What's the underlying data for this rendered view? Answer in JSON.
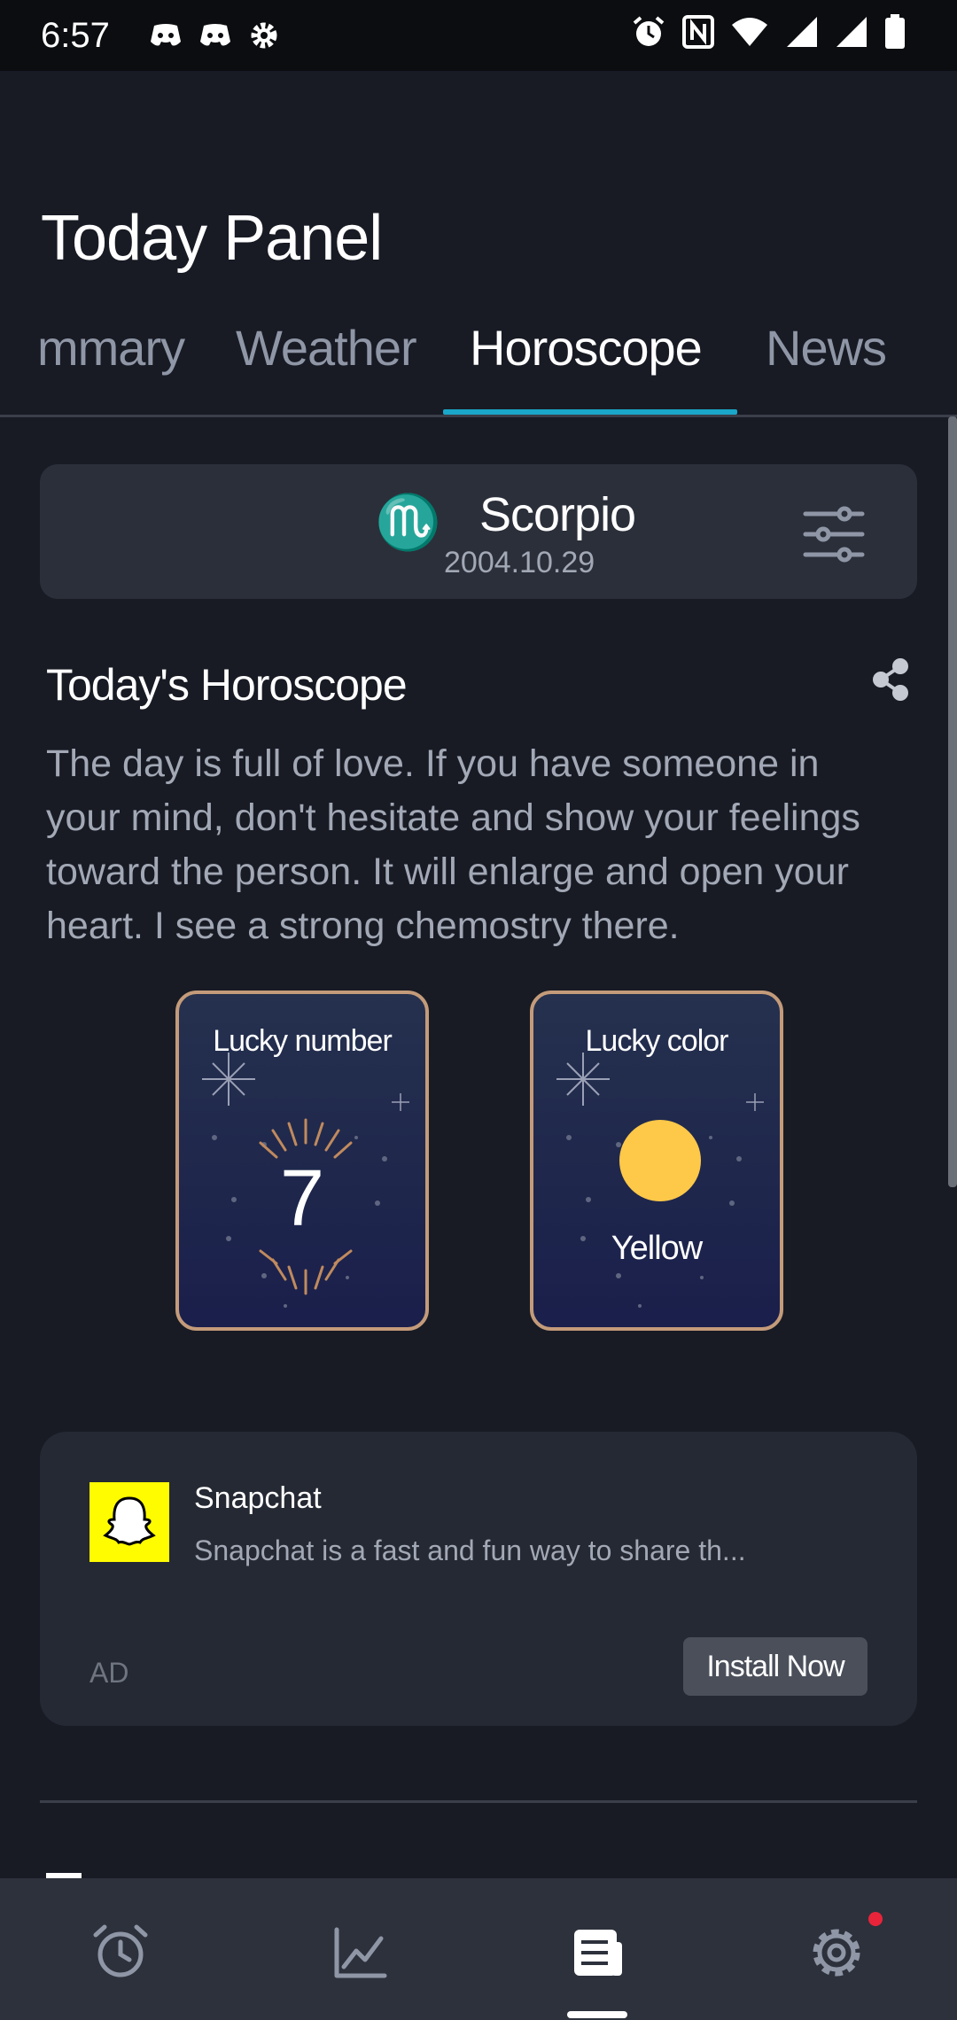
{
  "status_bar": {
    "time": "6:57",
    "icons": [
      "discord-icon",
      "discord-icon",
      "gear-icon",
      "alarm-icon",
      "nfc-icon",
      "wifi-icon",
      "signal-icon",
      "signal-icon",
      "battery-icon"
    ]
  },
  "page": {
    "title": "Today Panel"
  },
  "tabs": [
    {
      "label": "mmary"
    },
    {
      "label": "Weather"
    },
    {
      "label": "Horoscope",
      "active": true
    },
    {
      "label": "News"
    }
  ],
  "sign": {
    "glyph": "♏",
    "name": "Scorpio",
    "date": "2004.10.29"
  },
  "horoscope": {
    "title": "Today's Horoscope",
    "lines": [
      "The day is full of love. If you have someone in",
      "your mind, don't hesitate and show your feelings",
      "toward the person. It will enlarge and open your",
      "heart. I see a strong chemostry there."
    ]
  },
  "lucky": {
    "number_label": "Lucky number",
    "number": "7",
    "color_label": "Lucky color",
    "color_name": "Yellow",
    "color_hex": "#fec849"
  },
  "ad": {
    "app_name": "Snapchat",
    "description": "Snapchat is a fast and fun way to share th...",
    "tag": "AD",
    "button": "Install Now",
    "logo_color": "#fffc00"
  },
  "bottom_nav": {
    "items": [
      "alarm-clock-icon",
      "chart-icon",
      "news-icon",
      "settings-icon"
    ],
    "active": "news-icon"
  },
  "colors": {
    "accent": "#1aa7c9",
    "background": "#181b24",
    "card": "#2b2f3a",
    "badge": "#e8243a"
  }
}
